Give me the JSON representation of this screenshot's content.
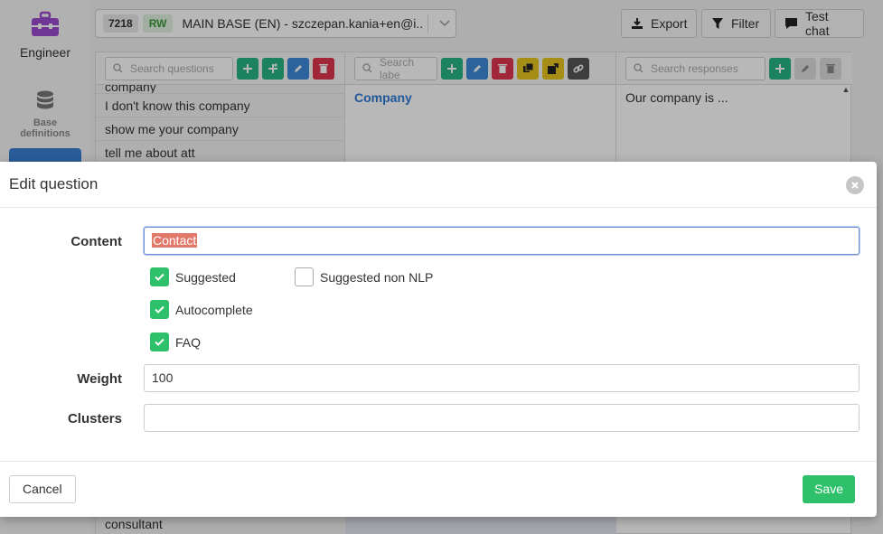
{
  "sidebar": {
    "engineer_label": "Engineer",
    "base_label_line1": "Base",
    "base_label_line2": "definitions"
  },
  "topbar": {
    "base_id": "7218",
    "mode": "RW",
    "base_name": "MAIN BASE (EN) - szczepan.kania+en@i..."
  },
  "toolbar": {
    "export_label": "Export",
    "filter_label": "Filter",
    "test_chat_label": "Test chat"
  },
  "questions": {
    "search_placeholder": "Search questions",
    "rows": [
      "company",
      "I don't know this company",
      "show me your company",
      "tell me about att"
    ],
    "bottom_row": "consultant"
  },
  "labels": {
    "search_placeholder": "Search labe",
    "head": "Company"
  },
  "responses": {
    "search_placeholder": "Search responses",
    "first": "Our company is ..."
  },
  "modal": {
    "title": "Edit question",
    "content_label": "Content",
    "content_value": "Contact",
    "checkbox_suggested": "Suggested",
    "checkbox_suggested_non_nlp": "Suggested non NLP",
    "checkbox_autocomplete": "Autocomplete",
    "checkbox_faq": "FAQ",
    "weight_label": "Weight",
    "weight_value": "100",
    "clusters_label": "Clusters",
    "clusters_value": "",
    "cancel_label": "Cancel",
    "save_label": "Save"
  },
  "colors": {
    "accent_green": "#2ec06a",
    "accent_blue": "#3b80d6",
    "danger_red": "#e0364e"
  }
}
